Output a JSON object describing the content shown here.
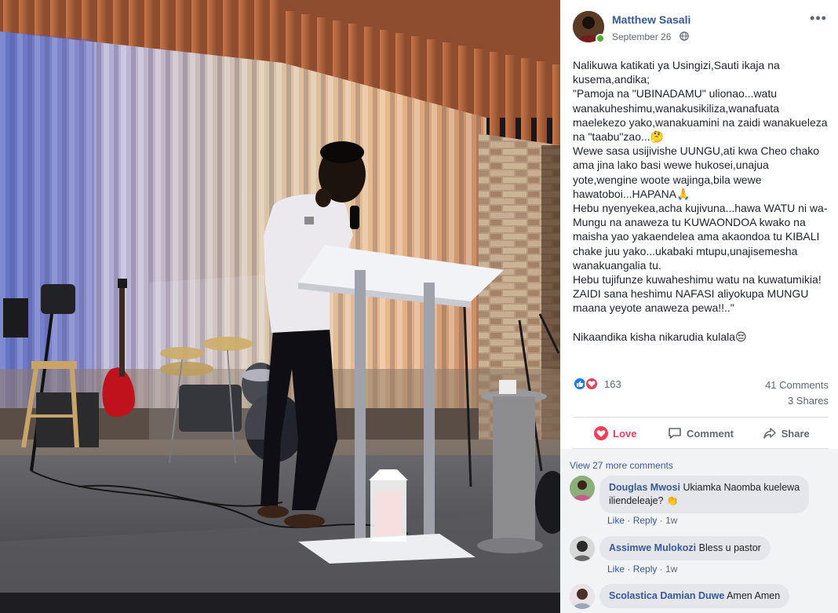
{
  "post": {
    "author": "Matthew Sasali",
    "date": "September 26",
    "more_glyph": "•••",
    "text_lines": [
      "Nalikuwa katikati ya Usingizi,Sauti ikaja na",
      "kusema,andika;",
      "\"Pamoja na \"UBINADAMU\" ulionao...watu",
      "wanakuheshimu,wanakusikiliza,wanafuata",
      "maelekezo yako,wanakuamini na zaidi wanakueleza",
      "na \"taabu\"zao...🤔",
      "Wewe sasa usijivishe UUNGU,ati kwa Cheo chako",
      "ama jina lako basi wewe hukosei,unajua",
      "yote,wengine woote wajinga,bila wewe",
      "hawatoboi...HAPANA🙏",
      "Hebu nyenyekea,acha kujivuna...hawa WATU ni wa-",
      "Mungu na anaweza tu KUWAONDOA kwako na",
      "maisha yao yakaendelea ama akaondoa tu KIBALI",
      "chake juu yako...ukabaki mtupu,unajisemesha",
      "wanakuangalia tu.",
      "Hebu tujifunze kuwaheshimu watu na kuwatumikia!",
      "ZAIDI sana heshimu NAFASI aliyokupa MUNGU",
      "maana yeyote anaweza pewa!!..\"",
      "",
      "Nikaandika kisha nikarudia kulala😔"
    ],
    "reactions_count": "163",
    "comments_count": "41 Comments",
    "shares_count": "3 Shares"
  },
  "actions": {
    "love": "Love",
    "comment": "Comment",
    "share": "Share"
  },
  "comments_section": {
    "view_more": "View 27 more comments",
    "comments": [
      {
        "author": "Douglas Mwosi",
        "text_line1": "Ukiamka Naomba kuelewa",
        "text_line2": "iliendeleaje? 👏",
        "like": "Like",
        "reply": "Reply",
        "time": "1w"
      },
      {
        "author": "Assimwe Mulokozi",
        "text_line1": "Bless u pastor",
        "like": "Like",
        "reply": "Reply",
        "time": "1w"
      },
      {
        "author": "Scolastica Damian Duwe",
        "text_line1": "Amen Amen"
      }
    ]
  },
  "colors": {
    "link_blue": "#385898",
    "love_red": "#f33e58",
    "like_blue": "#1877f2",
    "online_green": "#42b72a"
  },
  "icons": [
    "globe-icon",
    "like-reaction-icon",
    "love-reaction-icon",
    "love-heart-icon",
    "comment-bubble-icon",
    "share-arrow-icon"
  ]
}
